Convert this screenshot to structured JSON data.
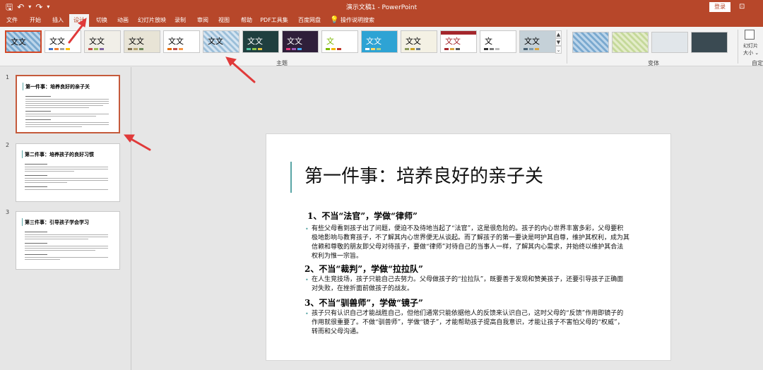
{
  "titlebar": {
    "title": "演示文稿1  -  PowerPoint",
    "login": "登录",
    "qat": {
      "save": "🖫",
      "undo": "↶",
      "undo_drop": "▾",
      "redo": "↷",
      "customize": "▾"
    },
    "ribbon_options": "⊡"
  },
  "tabs": [
    "文件",
    "开始",
    "插入",
    "设计",
    "切换",
    "动画",
    "幻灯片放映",
    "录制",
    "审阅",
    "视图",
    "帮助",
    "PDF工具集",
    "百度网盘",
    "操作说明搜索"
  ],
  "active_tab": "设计",
  "ribbon": {
    "themes_group": "主题",
    "variants_group": "变体",
    "customize_group": "自定",
    "slide_size_label": "幻灯片\n大小 ⌄",
    "theme_text": "文文",
    "theme_text_alt": "文",
    "scroll_up": "▲",
    "scroll_down": "▼",
    "scroll_more": "⌄"
  },
  "accent_color": "#b7472a",
  "thumbnails": [
    {
      "num": "1",
      "title": "第一件事：培养良好的亲子关"
    },
    {
      "num": "2",
      "title": "第二件事：培养孩子的良好习惯"
    },
    {
      "num": "3",
      "title": "第三件事：引导孩子学会学习"
    }
  ],
  "slide": {
    "title": "第一件事：培养良好的亲子关",
    "sections": [
      {
        "heading": "1、不当“法官”，学做“律师”",
        "text": "有些父母看到孩子出了问题，便迫不及待地当起了“法官”，这是很危险的。孩子的内心世界丰富多彩，父母要积极地影响与教育孩子，不了解其内心世界便无从谈起。而了解孩子的第一要诀是呵护其自尊，维护其权利，成为其信赖和尊敬的朋友即父母对待孩子，要做“律师”对待自己的当事人一样，了解其内心需求，并始终以维护其合法权利为惟一宗旨。"
      },
      {
        "heading": "2、不当“裁判”，学做“拉拉队”",
        "text": "在人生竞技场，孩子只能自己去努力。父母做孩子的“拉拉队”，既要善于发现和赞美孩子，还要引导孩子正确面对失败，在挫折面前做孩子的战友。"
      },
      {
        "heading": "3、不当“驯兽师”，学做“镜子”",
        "text": "孩子只有认识自己才能战胜自己，但他们通常只能依据他人的反馈来认识自己，这时父母的“反馈”作用即镜子的作用就很重要了。不做“驯兽师”，学做“镜子”，才能帮助孩子提高自我意识，才能让孩子不害怕父母的“权威”，转而和父母沟通。"
      }
    ],
    "bullet_char": "•"
  }
}
